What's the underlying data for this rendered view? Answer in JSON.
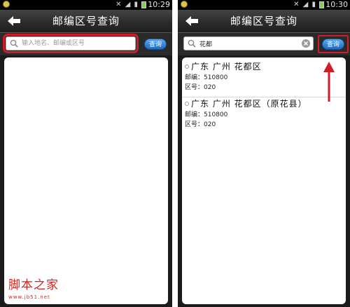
{
  "status_left": {
    "time": "10:29"
  },
  "status_right": {
    "time": "10:30"
  },
  "app": {
    "title": "邮编区号查询",
    "query_button": "查询"
  },
  "left": {
    "search_placeholder": "输入地名、邮编或区号"
  },
  "right": {
    "search_value": "花都",
    "results": [
      {
        "name": "广东 广州 花都区",
        "zip": "邮编：510800",
        "area_code": "区号：020"
      },
      {
        "name": "广东 广州 花都区（原花县）",
        "zip": "邮编：510800",
        "area_code": "区号：020"
      }
    ]
  },
  "watermark": {
    "title": "脚本之家",
    "url": "www.jb51.net"
  },
  "colors": {
    "highlight": "#d01c28",
    "button": "#2f84d8"
  },
  "icons": [
    "back-arrow-icon",
    "search-icon",
    "clear-icon",
    "mute-icon",
    "wifi-icon",
    "signal-icon",
    "battery-icon"
  ]
}
